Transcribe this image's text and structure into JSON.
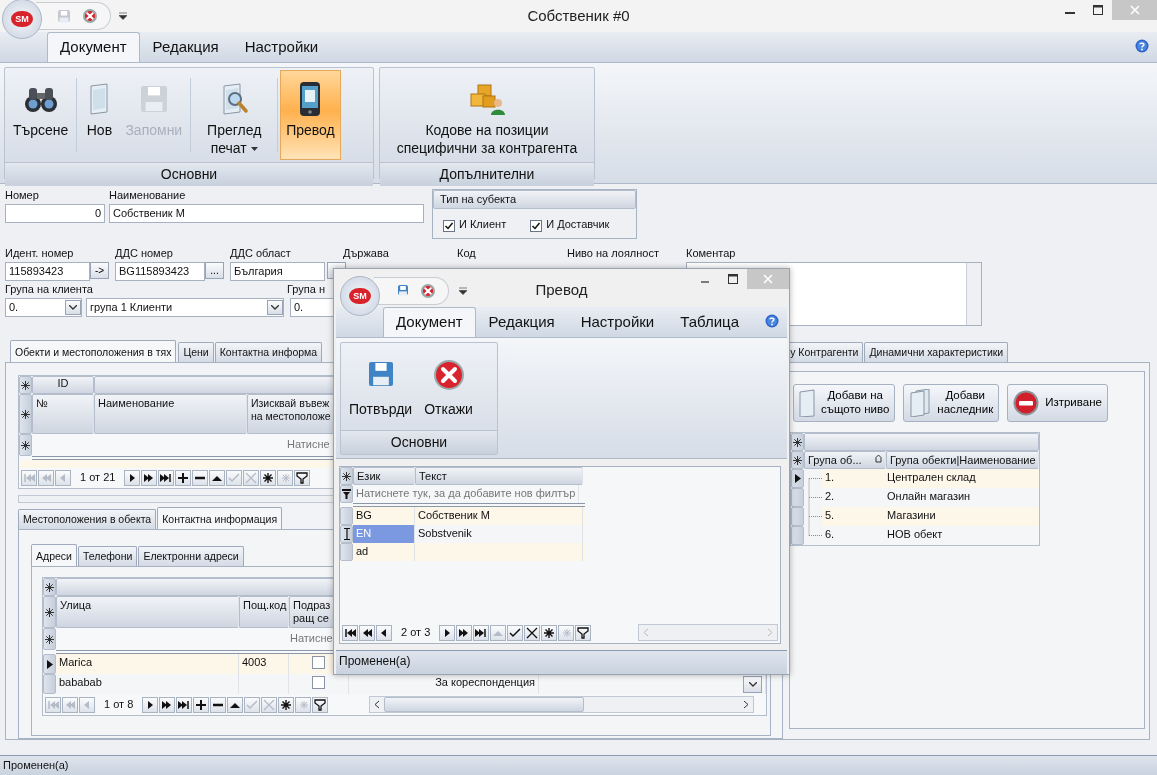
{
  "window": {
    "logo": "SM",
    "title": "Собственик #0",
    "quick_access": [
      {
        "kind": "save",
        "disabled": true
      },
      {
        "kind": "close",
        "disabled": false
      }
    ]
  },
  "ribbon": {
    "tabs": [
      {
        "label": "Документ",
        "selected": true
      },
      {
        "label": "Редакция",
        "selected": false
      },
      {
        "label": "Настройки",
        "selected": false
      }
    ],
    "groups": [
      {
        "label": "Основни",
        "buttons": [
          {
            "kind": "search",
            "label": "Търсене",
            "disabled": false,
            "selected": false,
            "dropdown": false
          },
          {
            "kind": "new",
            "label": "Нов",
            "disabled": false,
            "selected": false,
            "dropdown": false
          },
          {
            "kind": "save",
            "label": "Запомни",
            "disabled": true,
            "selected": false,
            "dropdown": false
          },
          {
            "kind": "preview",
            "label": "Преглед печат",
            "disabled": false,
            "selected": false,
            "dropdown": true
          },
          {
            "kind": "translate",
            "label": "Превод",
            "disabled": false,
            "selected": true,
            "dropdown": false
          }
        ]
      },
      {
        "label": "Допълнителни",
        "buttons": [
          {
            "kind": "codes",
            "label": "Кодове на позиции специфични за контрагента",
            "disabled": false,
            "selected": false,
            "dropdown": false
          }
        ]
      }
    ]
  },
  "form": {
    "number_label": "Номер",
    "number": "0",
    "name_label": "Наименование",
    "name": "Собственик М",
    "subject_type": {
      "title": "Тип на субекта",
      "options": [
        {
          "label": "И Клиент",
          "checked": true
        },
        {
          "label": "И Доставчик",
          "checked": true
        }
      ]
    },
    "labels": [
      "Идент. номер",
      "ДДС номер",
      "ДДС област",
      "Държава",
      "Код",
      "Ниво на лоялност",
      "Коментар"
    ],
    "ident": "115893423",
    "ident_button": "->",
    "vat": "BG115893423",
    "vat_button": "...",
    "vat_area": "България",
    "client_group_label": "Група на клиента",
    "client_group_code": "0.",
    "client_group": "група 1 Клиенти",
    "group2_label": "Група н",
    "group2_code": "0."
  },
  "tabs": [
    {
      "label": "Обекти и местоположения в тях",
      "selected": true
    },
    {
      "label": "Цени",
      "selected": false
    },
    {
      "label": "Контактна информа",
      "selected": false
    },
    {
      "label": "у Контрагенти",
      "selected": false
    },
    {
      "label": "Динамични характеристики",
      "selected": false
    }
  ],
  "objects_grid": {
    "band": "ID",
    "columns": [
      "№",
      "Наименование",
      "Изисквай въвеж\nна местоположе"
    ],
    "filter_hint": "Натисне",
    "pager": "1 от 21",
    "navigator": [
      {
        "kind": "first",
        "disabled": true
      },
      {
        "kind": "prev_page",
        "disabled": true
      },
      {
        "kind": "prev",
        "disabled": true
      },
      {
        "kind": "next",
        "disabled": false
      },
      {
        "kind": "next_page",
        "disabled": false
      },
      {
        "kind": "last",
        "disabled": false
      },
      {
        "kind": "append",
        "disabled": false
      },
      {
        "kind": "remove",
        "disabled": false
      },
      {
        "kind": "edit",
        "disabled": false
      },
      {
        "kind": "end_edit",
        "disabled": true
      },
      {
        "kind": "cancel_edit",
        "disabled": true
      },
      {
        "kind": "bookmark",
        "disabled": false
      },
      {
        "kind": "goto_bookmark",
        "disabled": true
      },
      {
        "kind": "filter",
        "disabled": false
      }
    ]
  },
  "sub_tabs": [
    {
      "label": "Местоположения в обекта",
      "selected": false
    },
    {
      "label": "Контактна информация",
      "selected": true
    }
  ],
  "contact_tabs": [
    {
      "label": "Адреси",
      "selected": true
    },
    {
      "label": "Телефони",
      "selected": false
    },
    {
      "label": "Електронни адреси",
      "selected": false
    }
  ],
  "addresses": {
    "columns": [
      "Улица",
      "Пощ.код",
      "Подраз\nращ се"
    ],
    "filter_hint": "Натисне",
    "rows": [
      {
        "street": "Marica",
        "postcode": "4003",
        "checked": false,
        "current": true
      },
      {
        "street": "bababab",
        "checked": false,
        "type": "За кореспонденция",
        "current": false
      }
    ],
    "pager": "1 от 8",
    "navigator": [
      {
        "kind": "first",
        "disabled": true
      },
      {
        "kind": "prev_page",
        "disabled": true
      },
      {
        "kind": "prev",
        "disabled": true
      },
      {
        "kind": "next",
        "disabled": false
      },
      {
        "kind": "next_page",
        "disabled": false
      },
      {
        "kind": "last",
        "disabled": false
      },
      {
        "kind": "append",
        "disabled": false
      },
      {
        "kind": "remove",
        "disabled": false
      },
      {
        "kind": "edit",
        "disabled": false
      },
      {
        "kind": "end_edit",
        "disabled": true
      },
      {
        "kind": "cancel_edit",
        "disabled": true
      },
      {
        "kind": "bookmark",
        "disabled": false
      },
      {
        "kind": "goto_bookmark",
        "disabled": true
      },
      {
        "kind": "filter",
        "disabled": false
      }
    ]
  },
  "objects_tree": {
    "buttons": [
      {
        "kind": "same_level",
        "label": "Добави на\nсъщото ниво"
      },
      {
        "kind": "child",
        "label": "Добави\nнаследник"
      },
      {
        "kind": "delete",
        "label": "Изтриване"
      }
    ],
    "columns": [
      "Група об...",
      "Група обекти|Наименование"
    ],
    "rows": [
      {
        "code": "1.",
        "name": "Централен склад",
        "current": true
      },
      {
        "code": "2.",
        "name": "Онлайн магазин",
        "current": false
      },
      {
        "code": "5.",
        "name": "Магазини",
        "current": false
      },
      {
        "code": "6.",
        "name": "НОВ обект",
        "current": false
      }
    ]
  },
  "status_bar": "Променен(а)",
  "dialog": {
    "logo": "SM",
    "title": "Превод",
    "tabs": [
      {
        "label": "Документ",
        "selected": true
      },
      {
        "label": "Редакция",
        "selected": false
      },
      {
        "label": "Настройки",
        "selected": false
      },
      {
        "label": "Таблица",
        "selected": false
      }
    ],
    "group": {
      "label": "Основни",
      "buttons": [
        {
          "kind": "confirm",
          "label": "Потвърди"
        },
        {
          "kind": "cancel",
          "label": "Откажи"
        }
      ]
    },
    "grid": {
      "columns": [
        "Език",
        "Текст"
      ],
      "filter_hint": "Натиснете тук, за да добавите нов филтър",
      "rows": [
        {
          "language": "BG",
          "text": "Собственик М",
          "selected": false
        },
        {
          "language": "EN",
          "text": "Sobstvenik",
          "selected": true
        },
        {
          "language": "ad",
          "selected": false
        }
      ]
    },
    "pager": "2 от 3",
    "navigator": [
      {
        "kind": "first",
        "disabled": false
      },
      {
        "kind": "prev_page",
        "disabled": false
      },
      {
        "kind": "prev",
        "disabled": false
      },
      {
        "kind": "next",
        "disabled": false
      },
      {
        "kind": "next_page",
        "disabled": false
      },
      {
        "kind": "last",
        "disabled": false
      },
      {
        "kind": "edit",
        "disabled": true
      },
      {
        "kind": "end_edit",
        "disabled": false
      },
      {
        "kind": "cancel_edit",
        "disabled": false
      },
      {
        "kind": "bookmark",
        "disabled": false
      },
      {
        "kind": "goto_bookmark",
        "disabled": true
      },
      {
        "kind": "filter",
        "disabled": false
      }
    ],
    "status": "Променен(а)"
  }
}
